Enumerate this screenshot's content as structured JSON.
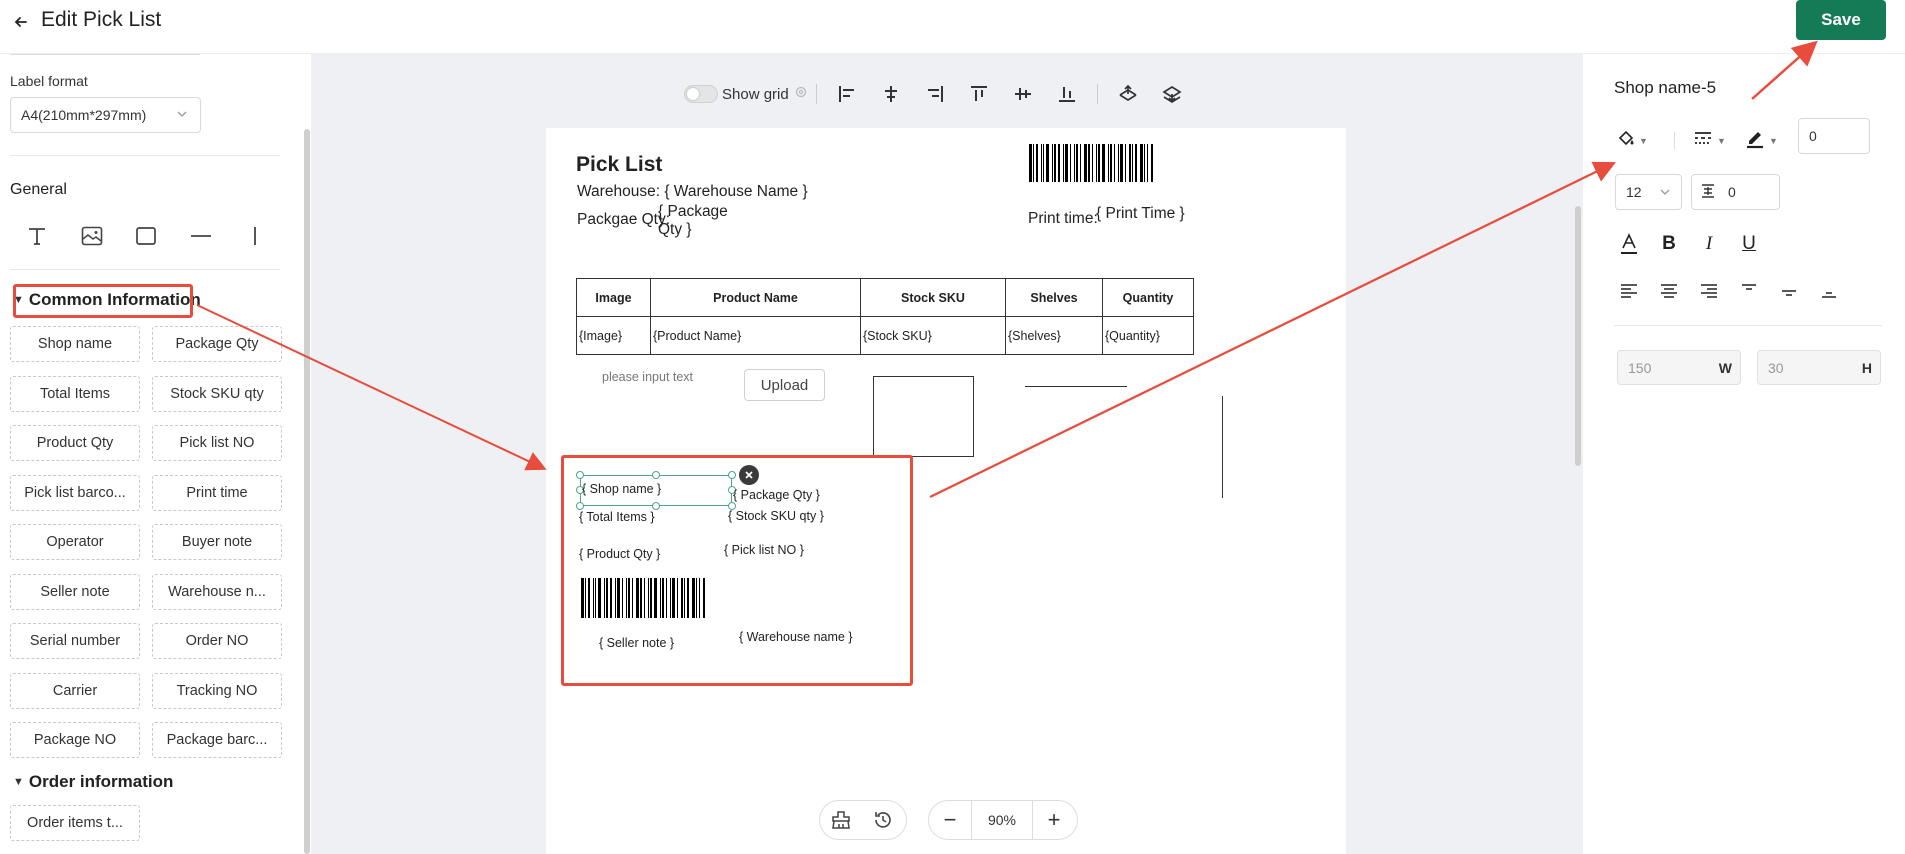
{
  "header": {
    "title": "Edit Pick List",
    "save_label": "Save"
  },
  "sidebar": {
    "label_format_title": "Label format",
    "label_format_value": "A4(210mm*297mm)",
    "general_title": "General",
    "tools": [
      "text-tool-icon",
      "image-tool-icon",
      "rectangle-tool-icon",
      "horizontal-line-tool-icon",
      "vertical-line-tool-icon"
    ],
    "common_title": "Common Information",
    "common_fields": [
      "Shop name",
      "Package Qty",
      "Total Items",
      "Stock SKU qty",
      "Product Qty",
      "Pick list NO",
      "Pick list barco...",
      "Print time",
      "Operator",
      "Buyer note",
      "Seller note",
      "Warehouse n...",
      "Serial number",
      "Order NO",
      "Carrier",
      "Tracking NO",
      "Package NO",
      "Package barc..."
    ],
    "order_title": "Order information",
    "order_fields": [
      "Order items t..."
    ]
  },
  "toolbar": {
    "show_grid_label": "Show grid",
    "icons": [
      "align-left-icon",
      "align-center-horizontal-icon",
      "align-right-icon",
      "align-top-icon",
      "align-middle-vertical-icon",
      "align-bottom-icon",
      "bring-forward-icon",
      "send-backward-icon"
    ]
  },
  "paper": {
    "title": "Pick List",
    "warehouse_label": "Warehouse:",
    "warehouse_value": "{ Warehouse Name }",
    "package_qty_label": "Packgae Qty:",
    "package_qty_value_1": "{ Package",
    "package_qty_value_2": "Qty }",
    "print_time_label": "Print time:",
    "print_time_value": "{ Print Time }",
    "table": {
      "headers": [
        "Image",
        "Product Name",
        "Stock SKU",
        "Shelves",
        "Quantity"
      ],
      "row": [
        "{Image}",
        "{Product Name}",
        "{Stock SKU}",
        "{Shelves}",
        "{Quantity}"
      ]
    },
    "placeholder_text": "please input text",
    "upload_label": "Upload",
    "label_fields": {
      "shop_name": "{ Shop name }",
      "package_qty": "{ Package Qty }",
      "total_items": "{ Total Items }",
      "stock_sku_qty": "{ Stock SKU qty }",
      "product_qty": "{ Product Qty }",
      "pick_list_no": "{ Pick list NO }",
      "seller_note": "{ Seller note }",
      "warehouse_name": "{ Warehouse name }"
    }
  },
  "zoom": {
    "value": "90%",
    "minus": "−",
    "plus": "+"
  },
  "right_panel": {
    "title": "Shop name-5",
    "border_width": "0",
    "font_size": "12",
    "line_spacing": "0",
    "width": "150",
    "width_suffix": "W",
    "height": "30",
    "height_suffix": "H"
  },
  "colors": {
    "primary": "#157a56",
    "annotation": "#e74c3c",
    "selection": "#4fa58f"
  }
}
